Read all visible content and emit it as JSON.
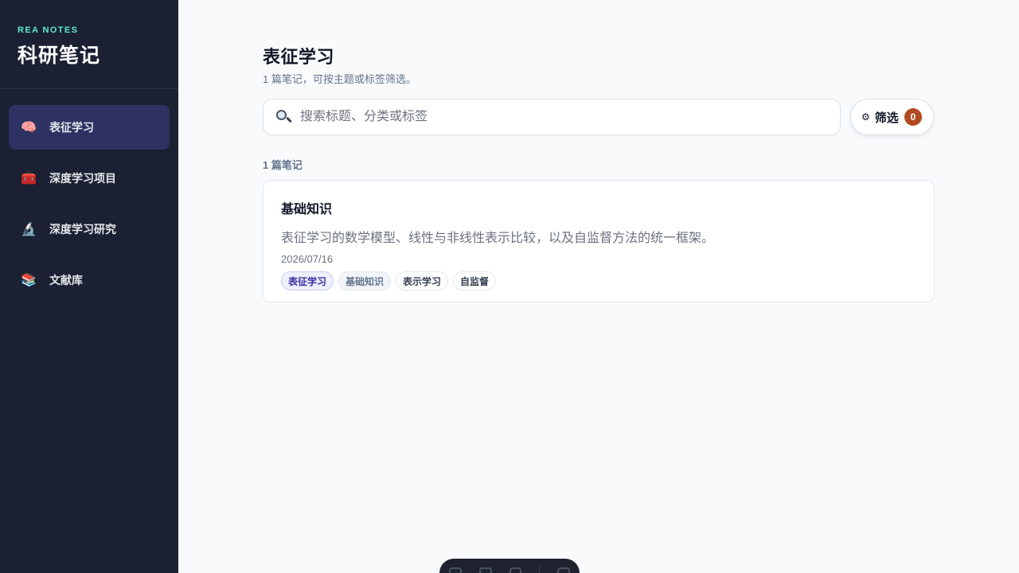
{
  "sidebar": {
    "eyebrow": "REA NOTES",
    "title": "科研笔记",
    "items": [
      {
        "icon": "brain-icon",
        "glyph": "🧠",
        "label": "表征学习",
        "active": true
      },
      {
        "icon": "toolbox-icon",
        "glyph": "🧰",
        "label": "深度学习项目",
        "active": false
      },
      {
        "icon": "microscope-icon",
        "glyph": "🔬",
        "label": "深度学习研究",
        "active": false
      },
      {
        "icon": "books-icon",
        "glyph": "📚",
        "label": "文献库",
        "active": false
      }
    ]
  },
  "main": {
    "title": "表征学习",
    "subtitle": "1 篇笔记，可按主题或标签筛选。",
    "search": {
      "placeholder": "搜索标题、分类或标签",
      "value": ""
    },
    "filter": {
      "label": "筛选",
      "count": "0",
      "icon": "gear-icon",
      "glyph": "⚙"
    },
    "count_label": "1 篇笔记",
    "notes": [
      {
        "title": "基础知识",
        "description": "表征学习的数学模型、线性与非线性表示比较，以及自监督方法的统一框架。",
        "date": "2026/07/16",
        "tags": [
          "表征学习",
          "基础知识",
          "表示学习",
          "自监督"
        ]
      }
    ]
  },
  "colors": {
    "sidebar_bg": "#1b2033",
    "accent": "#5eead4",
    "active_item": "#2d3263",
    "badge": "#b24a1f"
  }
}
